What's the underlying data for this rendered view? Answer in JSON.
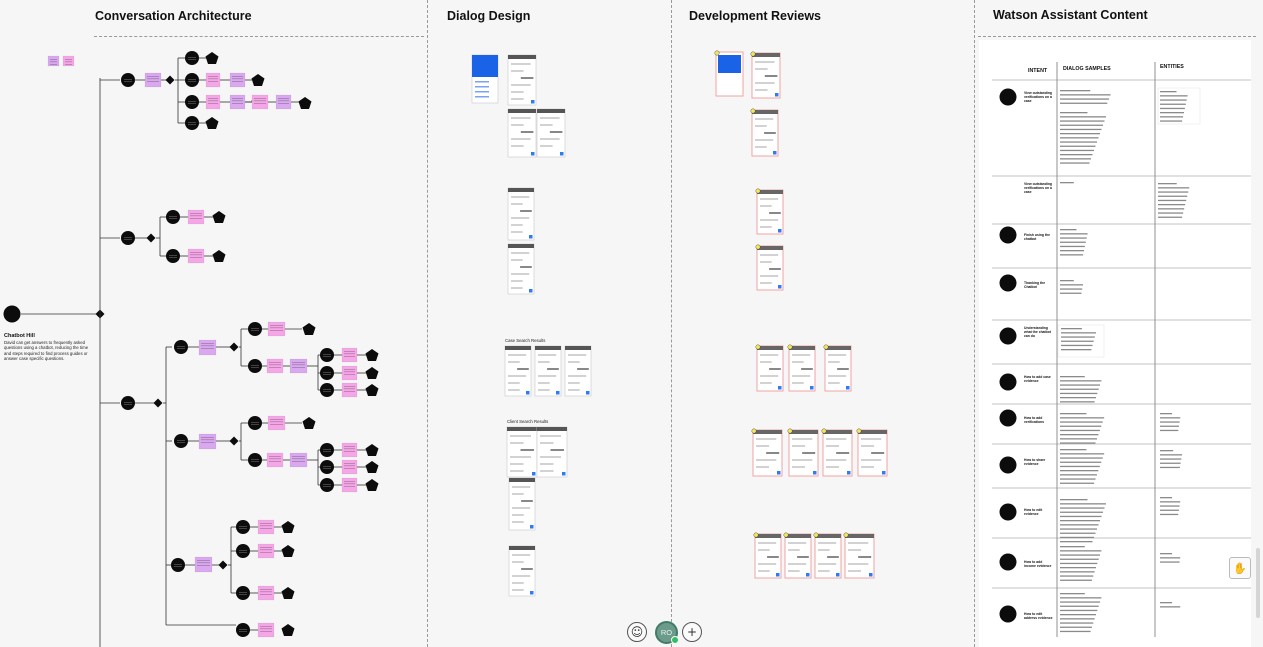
{
  "sections": {
    "conversation": "Conversation  Architecture",
    "dialog": "Dialog Design",
    "reviews": "Development Reviews",
    "watson": "Watson Assistant Content"
  },
  "root": {
    "title": "Chatbot Hill",
    "description": "David can get answers to frequently asked questions using a chatbot, reducing the time and steps required to find process guides or answer case specific questions."
  },
  "watson_table": {
    "headers": [
      "INTENT",
      "DIALOG SAMPLES",
      "ENTITIES"
    ],
    "intents": [
      "View outstanding verifications on a case",
      "View outstanding verifications on a case",
      "Finish using the chatbot",
      "Thanking the Chatbot",
      "Understanding what the chatbot can do",
      "How to add case evidence",
      "How to add verifications",
      "How to share evidence",
      "How to edit evidence",
      "How to add income evidence",
      "How to edit address evidence"
    ]
  },
  "dialog_subtitles": [
    "Case Search Results",
    "Client Search Results"
  ],
  "toolbar": {
    "emoji_icon": "☺",
    "avatar_initials": "RO",
    "add_icon": "+"
  },
  "hand_icon": "✋"
}
